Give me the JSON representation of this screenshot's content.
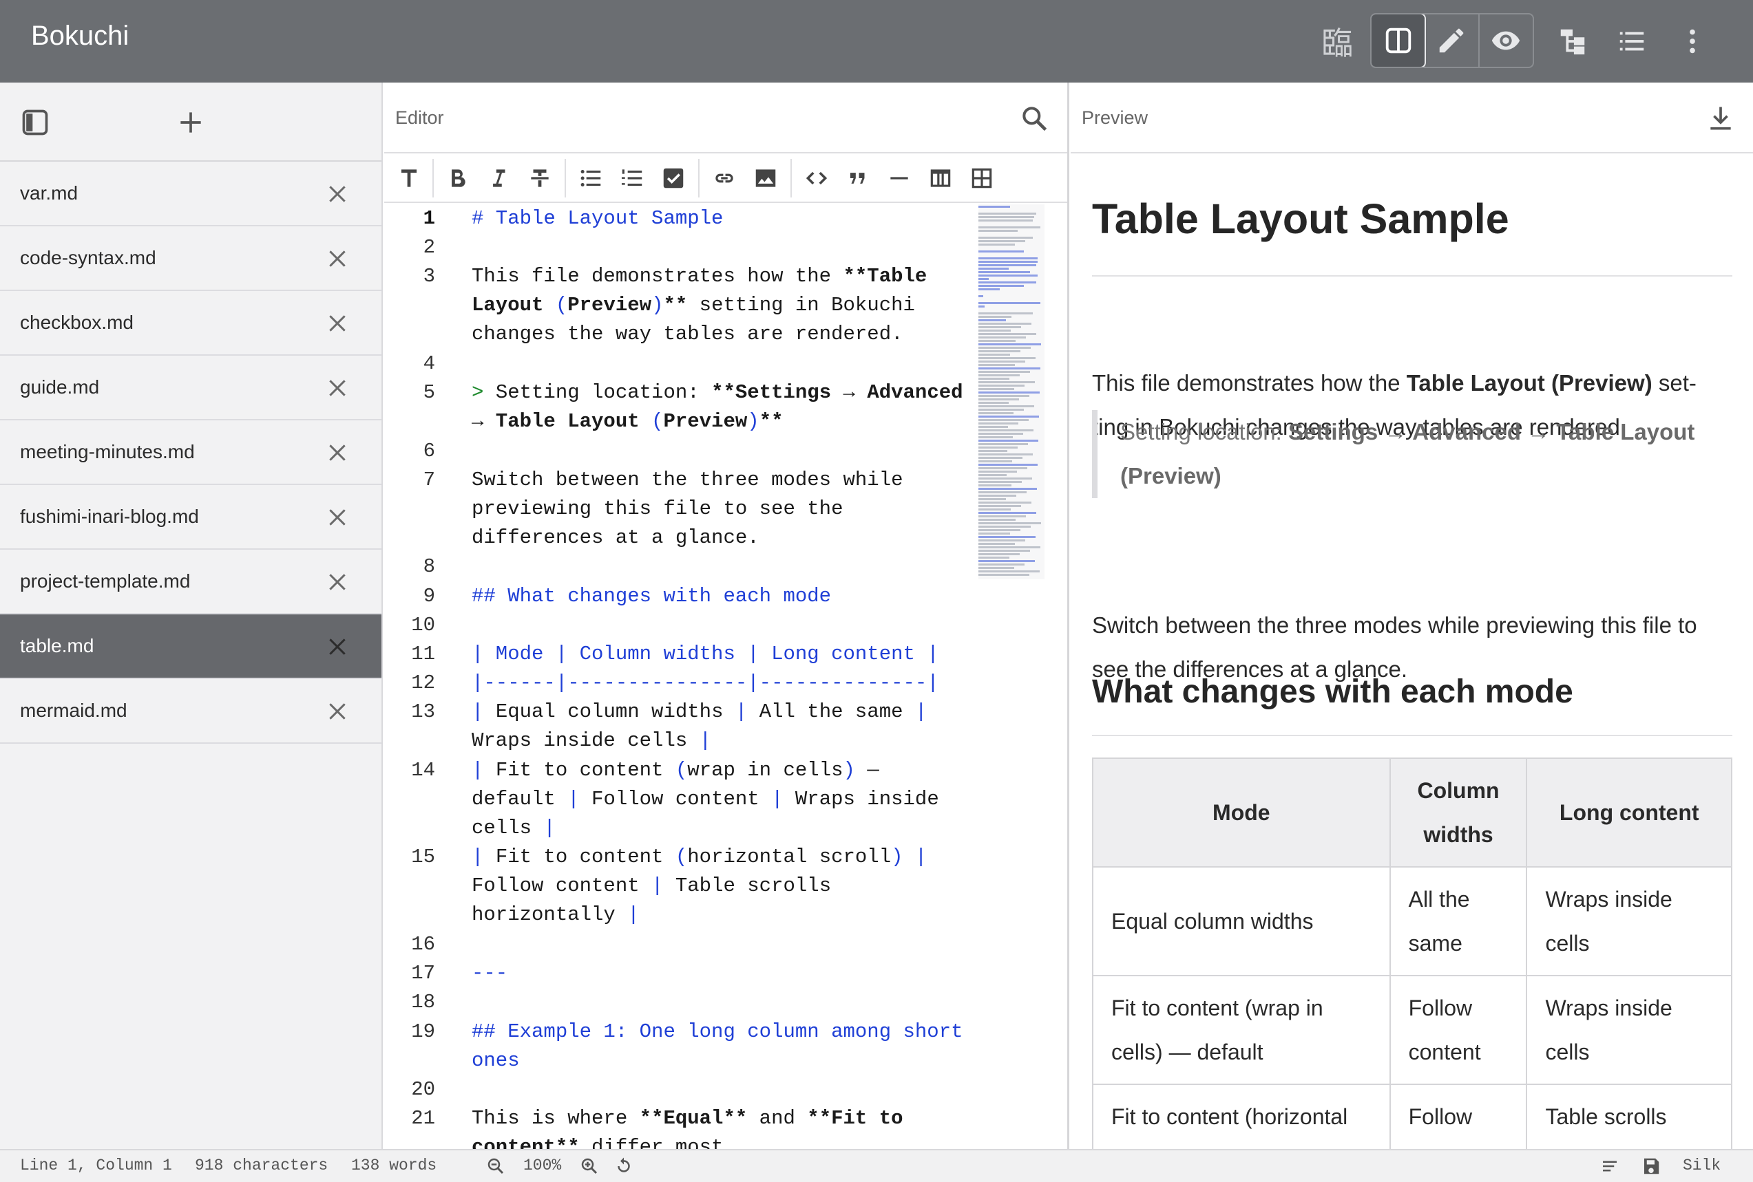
{
  "app": {
    "title": "Bokuchi"
  },
  "titlebar_icons": [
    "kanji-icon",
    "split-view-icon",
    "pencil-icon",
    "eye-icon",
    "outline-tree-icon",
    "list-icon",
    "more-vertical-icon"
  ],
  "titlebar": {
    "kanji": "臨"
  },
  "sidebar": {
    "files": [
      {
        "name": "var.md",
        "active": false
      },
      {
        "name": "code-syntax.md",
        "active": false
      },
      {
        "name": "checkbox.md",
        "active": false
      },
      {
        "name": "guide.md",
        "active": false
      },
      {
        "name": "meeting-minutes.md",
        "active": false
      },
      {
        "name": "fushimi-inari-blog.md",
        "active": false
      },
      {
        "name": "project-template.md",
        "active": false
      },
      {
        "name": "table.md",
        "active": true
      },
      {
        "name": "mermaid.md",
        "active": false
      }
    ]
  },
  "editor": {
    "title": "Editor",
    "lines": [
      {
        "n": "1",
        "segs": [
          [
            "b",
            "# Table Layout Sample"
          ]
        ]
      },
      {
        "n": "2",
        "segs": []
      },
      {
        "n": "3",
        "segs": [
          [
            "",
            "This file demonstrates how the "
          ],
          [
            "k",
            "**Table\nLayout "
          ],
          [
            "b",
            "("
          ],
          [
            "k",
            "Preview"
          ],
          [
            "b",
            ")"
          ],
          [
            "k",
            "**"
          ],
          [
            "",
            " setting in Bokuchi\nchanges the way tables are rendered."
          ]
        ]
      },
      {
        "n": "4",
        "segs": []
      },
      {
        "n": "5",
        "segs": [
          [
            "g",
            "> "
          ],
          [
            "",
            "Setting location: "
          ],
          [
            "k",
            "**Settings → Advanced\n→ Table Layout "
          ],
          [
            "b",
            "("
          ],
          [
            "k",
            "Preview"
          ],
          [
            "b",
            ")"
          ],
          [
            "k",
            "**"
          ]
        ]
      },
      {
        "n": "6",
        "segs": []
      },
      {
        "n": "7",
        "segs": [
          [
            "",
            "Switch between the three modes while\npreviewing this file to see the\ndifferences at a glance."
          ]
        ]
      },
      {
        "n": "8",
        "segs": []
      },
      {
        "n": "9",
        "segs": [
          [
            "b",
            "## What changes with each mode"
          ]
        ]
      },
      {
        "n": "10",
        "segs": []
      },
      {
        "n": "11",
        "segs": [
          [
            "b",
            "| Mode | Column widths | Long content |"
          ]
        ]
      },
      {
        "n": "12",
        "segs": [
          [
            "b",
            "|------|---------------|--------------|"
          ]
        ]
      },
      {
        "n": "13",
        "segs": [
          [
            "b",
            "| "
          ],
          [
            "",
            "Equal column widths "
          ],
          [
            "b",
            "| "
          ],
          [
            "",
            "All the same "
          ],
          [
            "b",
            "|\n"
          ],
          [
            "",
            "Wraps inside cells "
          ],
          [
            "b",
            "|"
          ]
        ]
      },
      {
        "n": "14",
        "segs": [
          [
            "b",
            "| "
          ],
          [
            "",
            "Fit to content "
          ],
          [
            "b",
            "("
          ],
          [
            "",
            "wrap in cells"
          ],
          [
            "b",
            ")"
          ],
          [
            "",
            " —\ndefault "
          ],
          [
            "b",
            "| "
          ],
          [
            "",
            "Follow content "
          ],
          [
            "b",
            "| "
          ],
          [
            "",
            "Wraps inside\ncells "
          ],
          [
            "b",
            "|"
          ]
        ]
      },
      {
        "n": "15",
        "segs": [
          [
            "b",
            "| "
          ],
          [
            "",
            "Fit to content "
          ],
          [
            "b",
            "("
          ],
          [
            "",
            "horizontal scroll"
          ],
          [
            "b",
            ")"
          ],
          [
            "b",
            " |\n"
          ],
          [
            "",
            "Follow content "
          ],
          [
            "b",
            "| "
          ],
          [
            "",
            "Table scrolls\nhorizontally "
          ],
          [
            "b",
            "|"
          ]
        ]
      },
      {
        "n": "16",
        "segs": []
      },
      {
        "n": "17",
        "segs": [
          [
            "b",
            "---"
          ]
        ]
      },
      {
        "n": "18",
        "segs": []
      },
      {
        "n": "19",
        "segs": [
          [
            "b",
            "## Example 1: One long column among short\nones"
          ]
        ]
      },
      {
        "n": "20",
        "segs": []
      },
      {
        "n": "21",
        "segs": [
          [
            "",
            "This is where "
          ],
          [
            "k",
            "**Equal**"
          ],
          [
            "",
            " and "
          ],
          [
            "k",
            "**Fit to\ncontent**"
          ],
          [
            "",
            " differ most."
          ]
        ]
      }
    ]
  },
  "preview": {
    "title": "Preview",
    "h1": "Table Layout Sample",
    "p1_a": "This file demonstrates how the ",
    "p1_b": "Table Layout (Preview)",
    "p1_c": " set-ting in Bokuchi changes the way tables are rendered.",
    "quote_a": "Setting location: ",
    "quote_b": "Settings → Advanced → Table Layout (Preview)",
    "p2": "Switch between the three modes while previewing this file to see the differences at a glance.",
    "h2": "What changes with each mode",
    "table": {
      "headers": [
        "Mode",
        "Column widths",
        "Long content"
      ],
      "rows": [
        [
          "Equal column widths",
          "All the same",
          "Wraps inside cells"
        ],
        [
          "Fit to content (wrap in cells) — default",
          "Follow content",
          "Wraps inside cells"
        ],
        [
          "Fit to content (horizontal scroll)",
          "Follow content",
          "Table scrolls horizontally"
        ]
      ]
    }
  },
  "status": {
    "position": "Line 1, Column 1",
    "chars": "918 characters",
    "words": "138 words",
    "zoom": "100%",
    "theme": "Silk"
  }
}
